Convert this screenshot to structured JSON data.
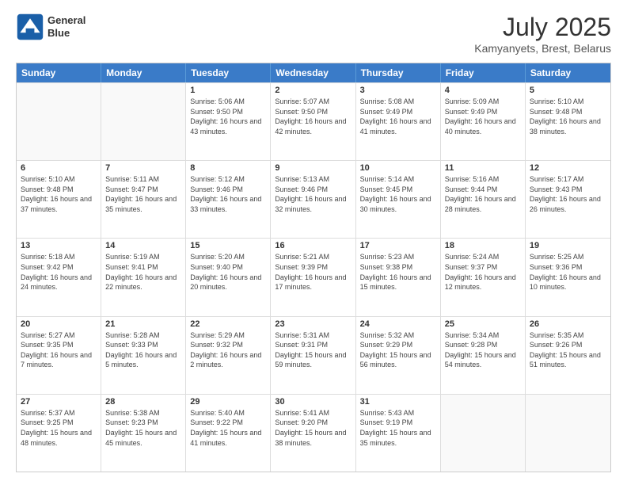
{
  "logo": {
    "line1": "General",
    "line2": "Blue"
  },
  "title": "July 2025",
  "location": "Kamyanyets, Brest, Belarus",
  "header_days": [
    "Sunday",
    "Monday",
    "Tuesday",
    "Wednesday",
    "Thursday",
    "Friday",
    "Saturday"
  ],
  "weeks": [
    [
      {
        "day": "",
        "info": ""
      },
      {
        "day": "",
        "info": ""
      },
      {
        "day": "1",
        "info": "Sunrise: 5:06 AM\nSunset: 9:50 PM\nDaylight: 16 hours and 43 minutes."
      },
      {
        "day": "2",
        "info": "Sunrise: 5:07 AM\nSunset: 9:50 PM\nDaylight: 16 hours and 42 minutes."
      },
      {
        "day": "3",
        "info": "Sunrise: 5:08 AM\nSunset: 9:49 PM\nDaylight: 16 hours and 41 minutes."
      },
      {
        "day": "4",
        "info": "Sunrise: 5:09 AM\nSunset: 9:49 PM\nDaylight: 16 hours and 40 minutes."
      },
      {
        "day": "5",
        "info": "Sunrise: 5:10 AM\nSunset: 9:48 PM\nDaylight: 16 hours and 38 minutes."
      }
    ],
    [
      {
        "day": "6",
        "info": "Sunrise: 5:10 AM\nSunset: 9:48 PM\nDaylight: 16 hours and 37 minutes."
      },
      {
        "day": "7",
        "info": "Sunrise: 5:11 AM\nSunset: 9:47 PM\nDaylight: 16 hours and 35 minutes."
      },
      {
        "day": "8",
        "info": "Sunrise: 5:12 AM\nSunset: 9:46 PM\nDaylight: 16 hours and 33 minutes."
      },
      {
        "day": "9",
        "info": "Sunrise: 5:13 AM\nSunset: 9:46 PM\nDaylight: 16 hours and 32 minutes."
      },
      {
        "day": "10",
        "info": "Sunrise: 5:14 AM\nSunset: 9:45 PM\nDaylight: 16 hours and 30 minutes."
      },
      {
        "day": "11",
        "info": "Sunrise: 5:16 AM\nSunset: 9:44 PM\nDaylight: 16 hours and 28 minutes."
      },
      {
        "day": "12",
        "info": "Sunrise: 5:17 AM\nSunset: 9:43 PM\nDaylight: 16 hours and 26 minutes."
      }
    ],
    [
      {
        "day": "13",
        "info": "Sunrise: 5:18 AM\nSunset: 9:42 PM\nDaylight: 16 hours and 24 minutes."
      },
      {
        "day": "14",
        "info": "Sunrise: 5:19 AM\nSunset: 9:41 PM\nDaylight: 16 hours and 22 minutes."
      },
      {
        "day": "15",
        "info": "Sunrise: 5:20 AM\nSunset: 9:40 PM\nDaylight: 16 hours and 20 minutes."
      },
      {
        "day": "16",
        "info": "Sunrise: 5:21 AM\nSunset: 9:39 PM\nDaylight: 16 hours and 17 minutes."
      },
      {
        "day": "17",
        "info": "Sunrise: 5:23 AM\nSunset: 9:38 PM\nDaylight: 16 hours and 15 minutes."
      },
      {
        "day": "18",
        "info": "Sunrise: 5:24 AM\nSunset: 9:37 PM\nDaylight: 16 hours and 12 minutes."
      },
      {
        "day": "19",
        "info": "Sunrise: 5:25 AM\nSunset: 9:36 PM\nDaylight: 16 hours and 10 minutes."
      }
    ],
    [
      {
        "day": "20",
        "info": "Sunrise: 5:27 AM\nSunset: 9:35 PM\nDaylight: 16 hours and 7 minutes."
      },
      {
        "day": "21",
        "info": "Sunrise: 5:28 AM\nSunset: 9:33 PM\nDaylight: 16 hours and 5 minutes."
      },
      {
        "day": "22",
        "info": "Sunrise: 5:29 AM\nSunset: 9:32 PM\nDaylight: 16 hours and 2 minutes."
      },
      {
        "day": "23",
        "info": "Sunrise: 5:31 AM\nSunset: 9:31 PM\nDaylight: 15 hours and 59 minutes."
      },
      {
        "day": "24",
        "info": "Sunrise: 5:32 AM\nSunset: 9:29 PM\nDaylight: 15 hours and 56 minutes."
      },
      {
        "day": "25",
        "info": "Sunrise: 5:34 AM\nSunset: 9:28 PM\nDaylight: 15 hours and 54 minutes."
      },
      {
        "day": "26",
        "info": "Sunrise: 5:35 AM\nSunset: 9:26 PM\nDaylight: 15 hours and 51 minutes."
      }
    ],
    [
      {
        "day": "27",
        "info": "Sunrise: 5:37 AM\nSunset: 9:25 PM\nDaylight: 15 hours and 48 minutes."
      },
      {
        "day": "28",
        "info": "Sunrise: 5:38 AM\nSunset: 9:23 PM\nDaylight: 15 hours and 45 minutes."
      },
      {
        "day": "29",
        "info": "Sunrise: 5:40 AM\nSunset: 9:22 PM\nDaylight: 15 hours and 41 minutes."
      },
      {
        "day": "30",
        "info": "Sunrise: 5:41 AM\nSunset: 9:20 PM\nDaylight: 15 hours and 38 minutes."
      },
      {
        "day": "31",
        "info": "Sunrise: 5:43 AM\nSunset: 9:19 PM\nDaylight: 15 hours and 35 minutes."
      },
      {
        "day": "",
        "info": ""
      },
      {
        "day": "",
        "info": ""
      }
    ]
  ]
}
